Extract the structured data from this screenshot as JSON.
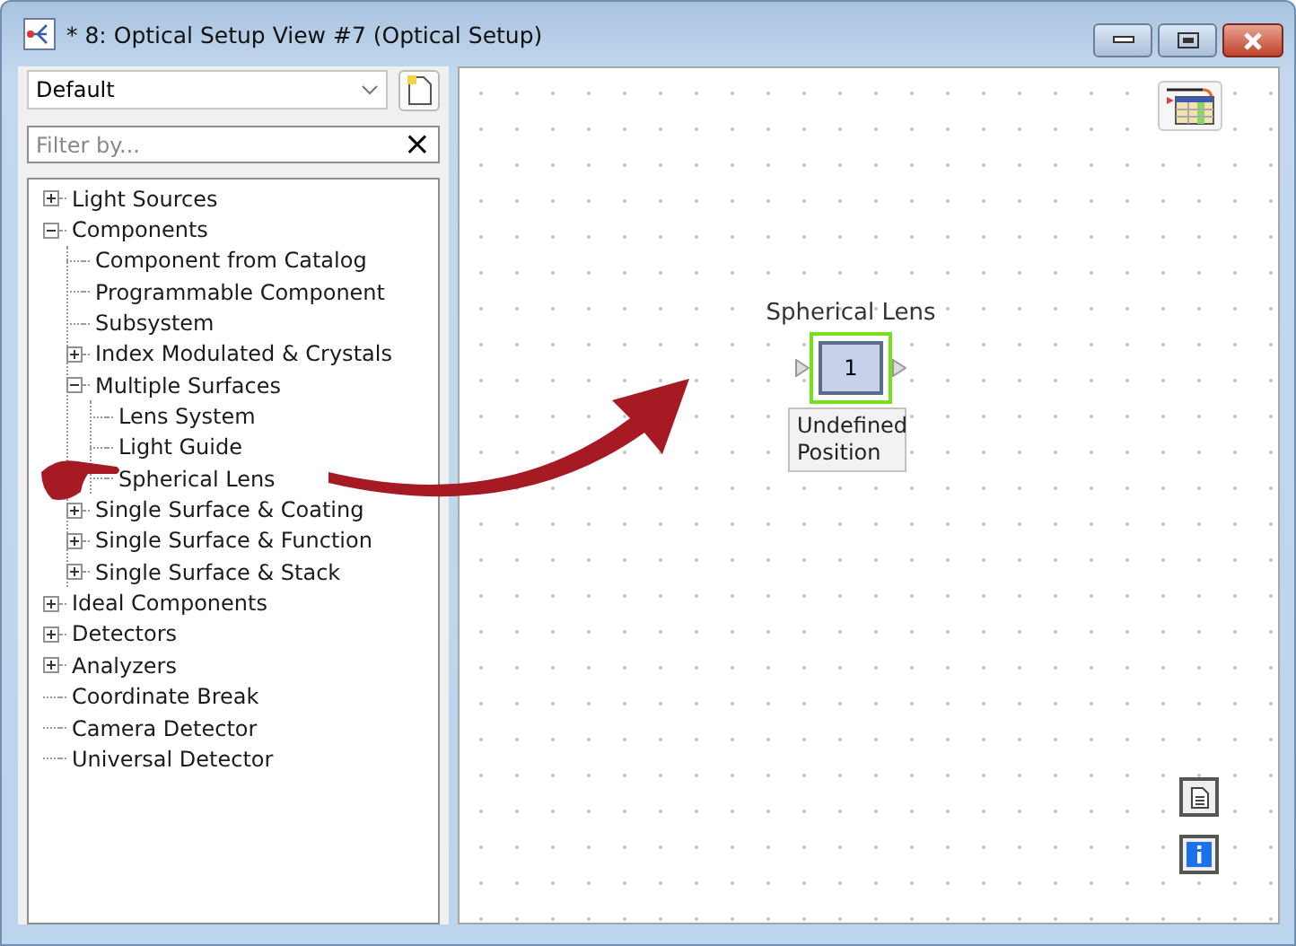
{
  "window": {
    "title": "* 8: Optical Setup View #7 (Optical Setup)"
  },
  "preset": {
    "value": "Default"
  },
  "filter": {
    "placeholder": "Filter by...",
    "clear": "×"
  },
  "tree": [
    {
      "label": "Light Sources",
      "kind": "group",
      "expanded": false
    },
    {
      "label": "Components",
      "kind": "group",
      "expanded": true,
      "children": [
        {
          "label": "Component from Catalog",
          "kind": "leaf"
        },
        {
          "label": "Programmable Component",
          "kind": "leaf"
        },
        {
          "label": "Subsystem",
          "kind": "leaf"
        },
        {
          "label": "Index Modulated & Crystals",
          "kind": "group",
          "expanded": false
        },
        {
          "label": "Multiple Surfaces",
          "kind": "group",
          "expanded": true,
          "children": [
            {
              "label": "Lens System",
              "kind": "leaf"
            },
            {
              "label": "Light Guide",
              "kind": "leaf"
            },
            {
              "label": "Spherical Lens",
              "kind": "leaf"
            }
          ]
        },
        {
          "label": "Single Surface & Coating",
          "kind": "group",
          "expanded": false
        },
        {
          "label": "Single Surface & Function",
          "kind": "group",
          "expanded": false
        },
        {
          "label": "Single Surface & Stack",
          "kind": "group",
          "expanded": false
        }
      ]
    },
    {
      "label": "Ideal Components",
      "kind": "group",
      "expanded": false
    },
    {
      "label": "Detectors",
      "kind": "group",
      "expanded": false
    },
    {
      "label": "Analyzers",
      "kind": "group",
      "expanded": false
    },
    {
      "label": "Coordinate Break",
      "kind": "leaf"
    },
    {
      "label": "Camera Detector",
      "kind": "leaf"
    },
    {
      "label": "Universal Detector",
      "kind": "leaf"
    }
  ],
  "canvas": {
    "nodes": [
      {
        "label": "Spherical Lens",
        "number": "1",
        "selected": true,
        "note": "Undefined Position"
      }
    ]
  }
}
